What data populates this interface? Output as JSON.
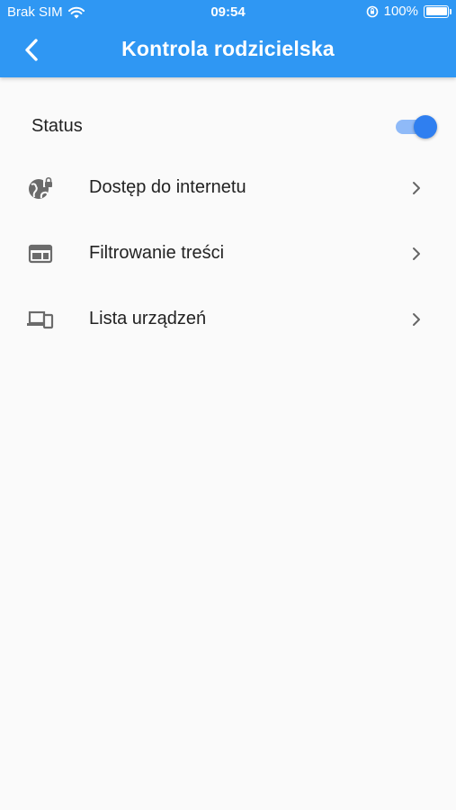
{
  "statusbar": {
    "carrier": "Brak SIM",
    "time": "09:54",
    "battery": "100%"
  },
  "header": {
    "title": "Kontrola rodzicielska"
  },
  "status": {
    "label": "Status",
    "enabled": true
  },
  "menu": [
    {
      "label": "Dostęp do internetu",
      "icon": "globe-lock-icon"
    },
    {
      "label": "Filtrowanie treści",
      "icon": "web-filter-icon"
    },
    {
      "label": "Lista urządzeń",
      "icon": "devices-icon"
    }
  ],
  "colors": {
    "primary": "#2f97f3",
    "toggle_on": "#2f7ff0",
    "toggle_track": "#8fbaf8",
    "icon": "#6b6b6b"
  }
}
